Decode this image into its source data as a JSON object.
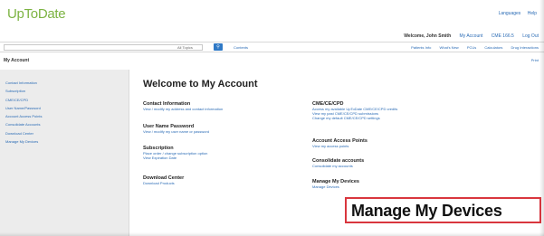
{
  "header": {
    "logo": "UpToDate",
    "top_links": [
      "Languages",
      "Help"
    ]
  },
  "userbar": {
    "welcome": "Welcome, John Smith",
    "links": [
      "My Account",
      "CME 166.5",
      "Log Out"
    ]
  },
  "search": {
    "placeholder": "",
    "scope": "All Topics",
    "contents_link": "Contents",
    "nav": [
      "Patients Info",
      "What's New",
      "PCUs",
      "Calculators",
      "Drug Interactions"
    ]
  },
  "title_bar": {
    "title": "My Account",
    "print": "Print"
  },
  "sidebar": {
    "items": [
      "Contact Information",
      "Subscription",
      "CME/CE/CPD",
      "User Name/Password",
      "Account Access Points",
      "Consolidate Accounts",
      "Download Center",
      "Manage My Devices"
    ]
  },
  "main": {
    "title": "Welcome to My Account",
    "left": [
      {
        "heading": "Contact Information",
        "lines": [
          "View / modify my address and contact information"
        ]
      },
      {
        "heading": "User Name Password",
        "lines": [
          "View / modify my user name or password"
        ]
      },
      {
        "heading": "Subscription",
        "lines": [
          "Place order / change subscription option",
          "View Expiration Date"
        ]
      },
      {
        "heading": "Download Center",
        "lines": [
          "Download Products"
        ]
      }
    ],
    "right": [
      {
        "heading": "CME/CE/CPD",
        "lines": [
          "Access my available UpToDate CME/CE/CPD credits",
          "View my past CME/CE/CPD submissions",
          "Change my default CME/CE/CPD settings"
        ]
      },
      {
        "heading": "Account Access Points",
        "lines": [
          "View my access points"
        ]
      },
      {
        "heading": "Consolidate accounts",
        "lines": [
          "Consolidate my accounts"
        ]
      },
      {
        "heading": "Manage My Devices",
        "lines": [
          "Manage Devices"
        ]
      }
    ]
  },
  "callout": {
    "text": "Manage My Devices",
    "border_color": "#d9363e"
  },
  "colors": {
    "brand": "#7cb342",
    "link": "#2a6bb5",
    "search_button": "#2f79c6"
  }
}
